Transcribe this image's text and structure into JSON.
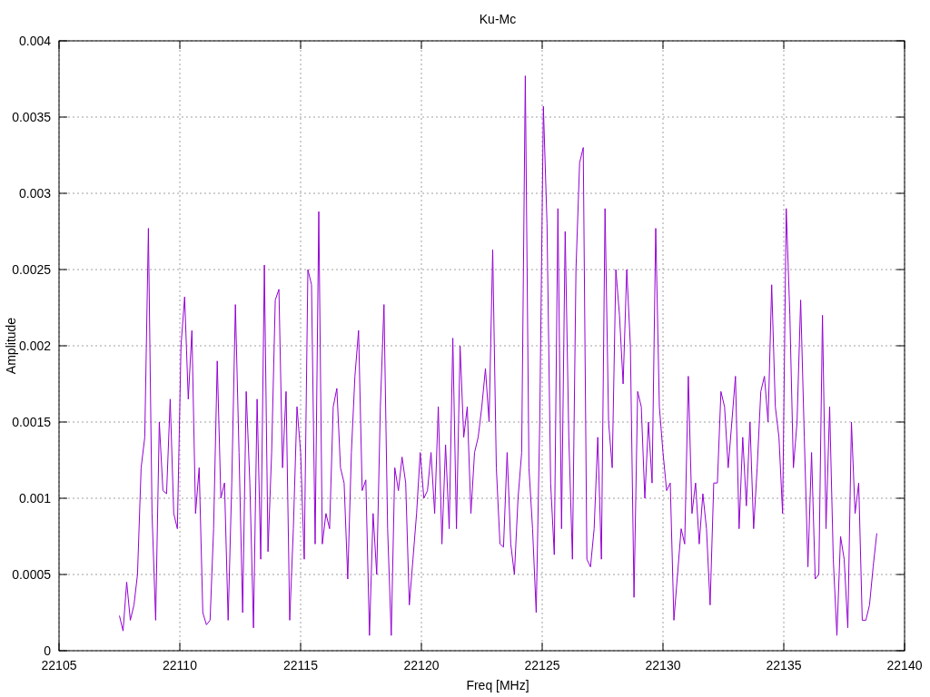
{
  "chart_data": {
    "type": "line",
    "title": "Ku-Mc",
    "xlabel": "Freq [MHz]",
    "ylabel": "Amplitude",
    "xlim": [
      22105,
      22140
    ],
    "ylim": [
      0,
      0.004
    ],
    "xticks": [
      22105,
      22110,
      22115,
      22120,
      22125,
      22130,
      22135,
      22140
    ],
    "yticks": [
      0,
      0.0005,
      0.001,
      0.0015,
      0.002,
      0.0025,
      0.003,
      0.0035,
      0.004
    ],
    "x": [
      22107.5,
      22107.65,
      22107.8,
      22107.95,
      22108.1,
      22108.25,
      22108.4,
      22108.55,
      22108.7,
      22108.85,
      22109,
      22109.15,
      22109.3,
      22109.45,
      22109.6,
      22109.75,
      22109.9,
      22110.05,
      22110.2,
      22110.35,
      22110.5,
      22110.65,
      22110.8,
      22110.95,
      22111.1,
      22111.25,
      22111.4,
      22111.55,
      22111.7,
      22111.85,
      22112,
      22112.15,
      22112.3,
      22112.45,
      22112.6,
      22112.75,
      22112.9,
      22113.05,
      22113.2,
      22113.35,
      22113.5,
      22113.65,
      22113.8,
      22113.95,
      22114.1,
      22114.25,
      22114.4,
      22114.55,
      22114.7,
      22114.85,
      22115,
      22115.15,
      22115.3,
      22115.45,
      22115.6,
      22115.75,
      22115.9,
      22116.05,
      22116.2,
      22116.35,
      22116.5,
      22116.65,
      22116.8,
      22116.95,
      22117.1,
      22117.25,
      22117.4,
      22117.55,
      22117.7,
      22117.85,
      22118,
      22118.15,
      22118.3,
      22118.45,
      22118.6,
      22118.75,
      22118.9,
      22119.05,
      22119.2,
      22119.35,
      22119.5,
      22119.65,
      22119.8,
      22119.95,
      22120.1,
      22120.25,
      22120.4,
      22120.55,
      22120.7,
      22120.85,
      22121,
      22121.15,
      22121.3,
      22121.45,
      22121.6,
      22121.75,
      22121.9,
      22122.05,
      22122.2,
      22122.35,
      22122.5,
      22122.65,
      22122.8,
      22122.95,
      22123.1,
      22123.25,
      22123.4,
      22123.55,
      22123.7,
      22123.85,
      22124,
      22124.15,
      22124.3,
      22124.45,
      22124.6,
      22124.75,
      22124.9,
      22125.05,
      22125.2,
      22125.35,
      22125.5,
      22125.65,
      22125.8,
      22125.95,
      22126.1,
      22126.25,
      22126.4,
      22126.55,
      22126.7,
      22126.85,
      22127,
      22127.15,
      22127.3,
      22127.45,
      22127.6,
      22127.75,
      22127.9,
      22128.05,
      22128.2,
      22128.35,
      22128.5,
      22128.65,
      22128.8,
      22128.95,
      22129.1,
      22129.25,
      22129.4,
      22129.55,
      22129.7,
      22129.85,
      22130,
      22130.15,
      22130.3,
      22130.45,
      22130.6,
      22130.75,
      22130.9,
      22131.05,
      22131.2,
      22131.35,
      22131.5,
      22131.65,
      22131.8,
      22131.95,
      22132.1,
      22132.25,
      22132.4,
      22132.55,
      22132.7,
      22132.85,
      22133,
      22133.15,
      22133.3,
      22133.45,
      22133.6,
      22133.75,
      22133.9,
      22134.05,
      22134.2,
      22134.35,
      22134.5,
      22134.65,
      22134.8,
      22134.95,
      22135.1,
      22135.25,
      22135.4,
      22135.55,
      22135.7,
      22135.85,
      22136,
      22136.15,
      22136.3,
      22136.45,
      22136.6,
      22136.75,
      22136.9,
      22137.05,
      22137.2,
      22137.35,
      22137.5,
      22137.65,
      22137.8,
      22137.95,
      22138.1,
      22138.25,
      22138.4,
      22138.55,
      22138.7,
      22138.85
    ],
    "grid": true,
    "series": [
      {
        "color": "#9400d3",
        "values": [
          0.00023,
          0.00013,
          0.00045,
          0.0002,
          0.0003,
          0.0005,
          0.0012,
          0.0014,
          0.00277,
          0.0009,
          0.0002,
          0.0015,
          0.00105,
          0.00103,
          0.00165,
          0.0009,
          0.0008,
          0.002,
          0.00232,
          0.00165,
          0.0021,
          0.0009,
          0.0012,
          0.00025,
          0.00017,
          0.0002,
          0.0008,
          0.0019,
          0.001,
          0.0011,
          0.0002,
          0.0011,
          0.00227,
          0.0013,
          0.00025,
          0.0017,
          0.0011,
          0.00015,
          0.00165,
          0.0006,
          0.00253,
          0.00065,
          0.0013,
          0.0023,
          0.00237,
          0.0012,
          0.0017,
          0.0002,
          0.0008,
          0.0016,
          0.0013,
          0.0006,
          0.0025,
          0.0024,
          0.0007,
          0.00288,
          0.0007,
          0.0009,
          0.0008,
          0.0016,
          0.00172,
          0.0012,
          0.0011,
          0.00047,
          0.0013,
          0.0018,
          0.0021,
          0.00105,
          0.00112,
          0.0001,
          0.0009,
          0.0005,
          0.0016,
          0.00227,
          0.0008,
          0.0001,
          0.0012,
          0.00105,
          0.00127,
          0.0011,
          0.0003,
          0.0006,
          0.0009,
          0.0013,
          0.001,
          0.00105,
          0.0013,
          0.0009,
          0.0016,
          0.0007,
          0.00135,
          0.0008,
          0.00205,
          0.0008,
          0.002,
          0.0014,
          0.0016,
          0.0009,
          0.0013,
          0.0014,
          0.0016,
          0.00185,
          0.0015,
          0.00263,
          0.0012,
          0.0007,
          0.00068,
          0.0013,
          0.0007,
          0.0005,
          0.001,
          0.0013,
          0.00377,
          0.0012,
          0.0008,
          0.00025,
          0.0015,
          0.00357,
          0.0028,
          0.0011,
          0.00063,
          0.0029,
          0.0008,
          0.00275,
          0.0014,
          0.0006,
          0.0025,
          0.0032,
          0.0033,
          0.0006,
          0.00055,
          0.0008,
          0.0014,
          0.0006,
          0.0029,
          0.0015,
          0.0012,
          0.0025,
          0.0022,
          0.00175,
          0.0025,
          0.002,
          0.00035,
          0.0017,
          0.0016,
          0.001,
          0.0015,
          0.0011,
          0.00277,
          0.0016,
          0.0013,
          0.00105,
          0.0011,
          0.0002,
          0.0005,
          0.0008,
          0.0007,
          0.0018,
          0.0009,
          0.0011,
          0.0007,
          0.00103,
          0.0008,
          0.0003,
          0.0011,
          0.0011,
          0.0017,
          0.0016,
          0.0012,
          0.0015,
          0.0018,
          0.0008,
          0.0014,
          0.00095,
          0.0015,
          0.0008,
          0.0012,
          0.0017,
          0.0018,
          0.0015,
          0.0024,
          0.0016,
          0.0014,
          0.0009,
          0.0029,
          0.0022,
          0.0012,
          0.0015,
          0.0023,
          0.0014,
          0.00055,
          0.0013,
          0.00047,
          0.0005,
          0.0022,
          0.0008,
          0.0016,
          0.0006,
          0.0001,
          0.00075,
          0.0006,
          0.00015,
          0.0015,
          0.0009,
          0.0011,
          0.0002,
          0.0002,
          0.0003,
          0.00055,
          0.00077
        ]
      }
    ]
  }
}
